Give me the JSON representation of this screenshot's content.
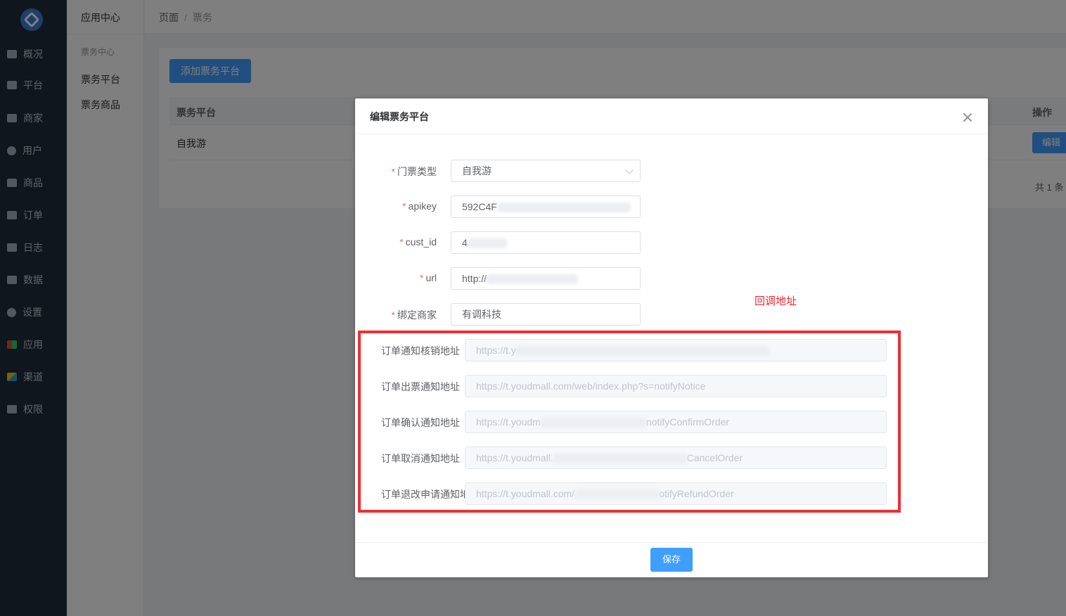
{
  "sidebar": {
    "logo_icon": "app-logo-icon",
    "items": [
      {
        "label": "概况",
        "icon": "chart-icon"
      },
      {
        "label": "平台",
        "icon": "monitor-icon"
      },
      {
        "label": "商家",
        "icon": "store-icon"
      },
      {
        "label": "用户",
        "icon": "user-icon"
      },
      {
        "label": "商品",
        "icon": "goods-icon"
      },
      {
        "label": "订单",
        "icon": "order-icon"
      },
      {
        "label": "日志",
        "icon": "log-icon"
      },
      {
        "label": "数据",
        "icon": "bar-chart-icon"
      },
      {
        "label": "设置",
        "icon": "gear-icon"
      },
      {
        "label": "应用",
        "icon": "apps-icon"
      },
      {
        "label": "渠道",
        "icon": "cube-icon"
      },
      {
        "label": "权限",
        "icon": "lock-icon"
      }
    ]
  },
  "subnav": {
    "title": "应用中心",
    "group": "票务中心",
    "items": [
      "票务平台",
      "票务商品"
    ]
  },
  "breadcrumb": {
    "home": "页面",
    "separator": "/",
    "current": "票务"
  },
  "main": {
    "add_button": "添加票务平台",
    "table": {
      "headers": [
        "票务平台",
        "操作"
      ],
      "rows": [
        {
          "platform": "自我游",
          "action": "编辑"
        }
      ]
    },
    "total": "共 1 条"
  },
  "dialog": {
    "title": "编辑票务平台",
    "fields": [
      {
        "label": "门票类型",
        "required": true,
        "value": "自我游",
        "type": "select"
      },
      {
        "label": "apikey",
        "required": true,
        "value": "592C4F"
      },
      {
        "label": "cust_id",
        "required": true,
        "value": "4"
      },
      {
        "label": "url",
        "required": true,
        "value": "http://"
      },
      {
        "label": "绑定商家",
        "required": true,
        "value": "有调科技"
      }
    ],
    "callback_fields": [
      {
        "label": "订单通知核销地址",
        "value": "https://t.y"
      },
      {
        "label": "订单出票通知地址",
        "value": "https://t.youdmall.com/web/index.php?s=notifyNotice"
      },
      {
        "label": "订单确认通知地址",
        "value": "https://t.youdm",
        "tail": "notifyConfirmOrder"
      },
      {
        "label": "订单取消通知地址",
        "value": "https://t.youdmall.",
        "tail": "CancelOrder"
      },
      {
        "label": "订单退改申请通知地",
        "value": "https://t.youdmall.com/",
        "tail": "otifyRefundOrder"
      }
    ],
    "annotation": "回调地址",
    "save_button": "保存"
  },
  "colors": {
    "sidebar_bg": "#1f2c3c",
    "primary": "#409eff",
    "annotation_red": "#ee2f36",
    "required_red": "#f56c6c"
  }
}
